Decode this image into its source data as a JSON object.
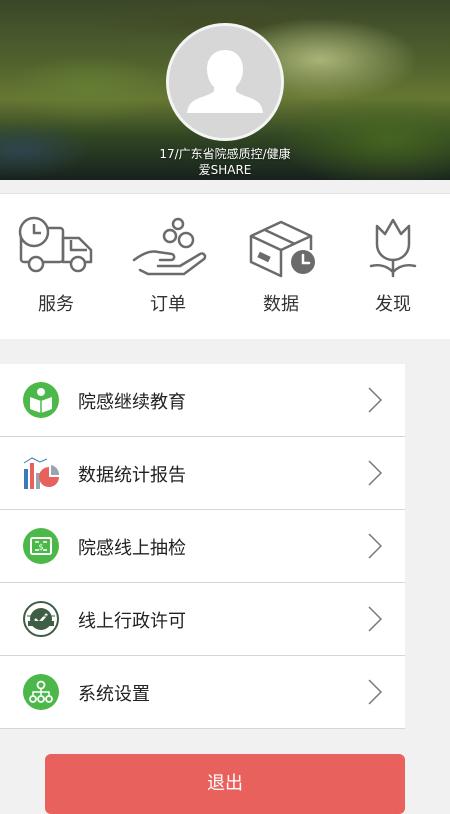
{
  "profile": {
    "name_line1": "17/广东省院感质控/健康",
    "name_line2": "爱SHARE"
  },
  "quick_actions": [
    {
      "label": "服务",
      "icon": "delivery-truck-clock-icon"
    },
    {
      "label": "订单",
      "icon": "hand-coins-icon"
    },
    {
      "label": "数据",
      "icon": "box-clock-icon"
    },
    {
      "label": "发现",
      "icon": "tulip-icon"
    }
  ],
  "menu": [
    {
      "label": "院感继续教育",
      "icon": "book-reader-icon"
    },
    {
      "label": "数据统计报告",
      "icon": "bar-pie-chart-icon"
    },
    {
      "label": "院感线上抽检",
      "icon": "money-bill-icon"
    },
    {
      "label": "线上行政许可",
      "icon": "quality-assurance-badge-icon"
    },
    {
      "label": "系统设置",
      "icon": "network-hierarchy-icon"
    }
  ],
  "logout_label": "退出",
  "colors": {
    "accent_green": "#4db84a",
    "logout_red": "#e8615c",
    "icon_gray": "#6b6b6b"
  }
}
